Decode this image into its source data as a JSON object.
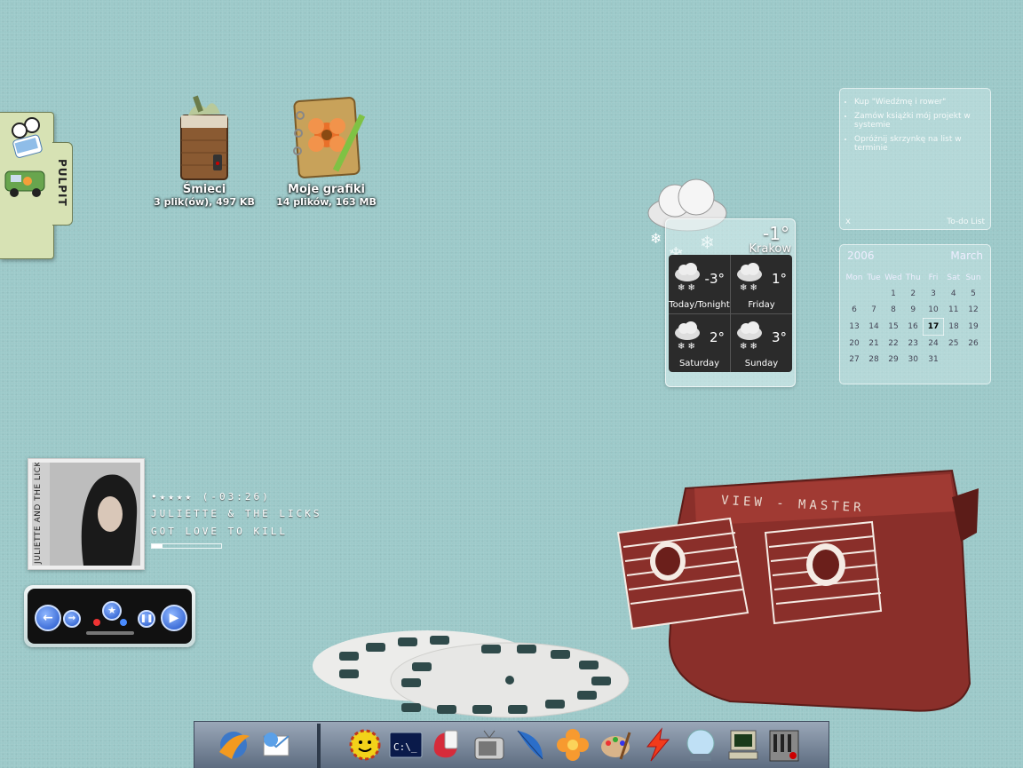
{
  "desktop": {
    "icons": [
      {
        "label": "Śmieci",
        "sub": "3 plik(ów), 497 KB",
        "icon": "trash-icon"
      },
      {
        "label": "Moje grafiki",
        "sub": "14 plików,  163 MB",
        "icon": "scrapbook-icon"
      }
    ]
  },
  "pulpit": {
    "label": "PULPIT"
  },
  "weather": {
    "temp": "-1°",
    "city": "Krakow",
    "forecast": [
      {
        "temp": "-3°",
        "day": "Today/Tonight"
      },
      {
        "temp": "1°",
        "day": "Friday"
      },
      {
        "temp": "2°",
        "day": "Saturday"
      },
      {
        "temp": "3°",
        "day": "Sunday"
      }
    ]
  },
  "todo": {
    "items": [
      "Kup \"Wiedźmę i rower\"",
      "Zamów książki mój projekt w systemie",
      "Opróżnij skrzynkę na list w terminie"
    ],
    "close": "x",
    "title": "To-do List"
  },
  "calendar": {
    "year": "2006",
    "month": "March",
    "weekdays": [
      "Mon",
      "Tue",
      "Wed",
      "Thu",
      "Fri",
      "Sat",
      "Sun"
    ],
    "weeks": [
      [
        "",
        "",
        "",
        "1",
        "2",
        "3",
        "4",
        "5"
      ],
      [
        "6",
        "7",
        "8",
        "9",
        "10",
        "11",
        "12"
      ],
      [
        "13",
        "14",
        "15",
        "16",
        "17",
        "18",
        "19"
      ],
      [
        "20",
        "21",
        "22",
        "23",
        "24",
        "25",
        "26"
      ],
      [
        "27",
        "28",
        "29",
        "30",
        "31",
        "",
        ""
      ]
    ],
    "today": "17"
  },
  "player": {
    "rating_time": "•★★★★ (-03:26)",
    "artist": "JULIETTE & THE LICKS",
    "title": "GOT LOVE TO KILL",
    "album_text": "JULIETTE AND THE LICKS",
    "progress": 0.15
  },
  "viewmaster": {
    "brand": "VIEW - MASTER"
  },
  "colors": {
    "desktop": "#9cc9c9",
    "viewmaster": "#8a2f2a",
    "dock": "#7a889c"
  }
}
